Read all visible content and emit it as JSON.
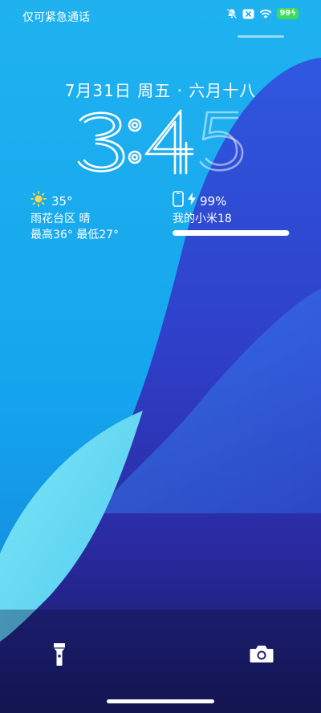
{
  "status_bar": {
    "carrier_text": "仅可紧急通话",
    "battery_level": "99"
  },
  "lockscreen": {
    "date_text": "7月31日 周五 · 六月十八",
    "time": "3:45"
  },
  "weather": {
    "icon": "sun-icon",
    "temperature": "35°",
    "location_condition": "雨花台区 晴",
    "high_low": "最高36° 最低27°"
  },
  "device": {
    "icon": "phone-icon",
    "battery_text": "99%",
    "device_name": "我的小米18",
    "battery_fraction": 0.99
  },
  "shortcuts": {
    "left": "flashlight-icon",
    "right": "camera-icon"
  },
  "colors": {
    "sky_top": "#23b6f0",
    "deep_blue": "#2634b8",
    "navy": "#17195e",
    "cyan_wave": "#76e2f4",
    "battery_green": "#3ddc58"
  }
}
